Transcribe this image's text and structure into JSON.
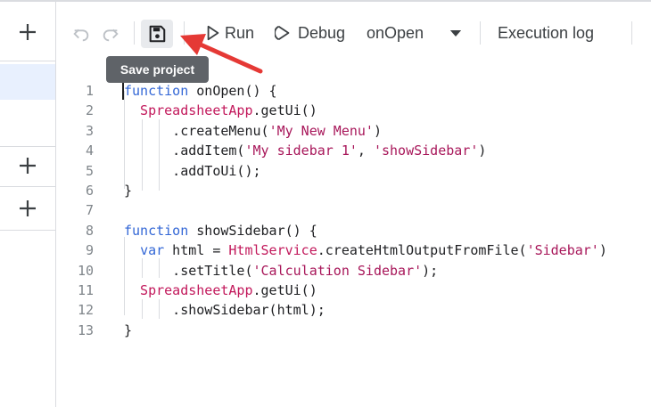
{
  "toolbar": {
    "run_label": "Run",
    "debug_label": "Debug",
    "function_select": "onOpen",
    "execution_log_label": "Execution log",
    "tooltip": "Save project"
  },
  "code_lines": [
    {
      "n": "1",
      "parts": [
        [
          "kw",
          "function"
        ],
        [
          "p",
          " onOpen() {"
        ]
      ]
    },
    {
      "n": "2",
      "parts": [
        [
          "cls",
          "  SpreadsheetApp"
        ],
        [
          "p",
          ".getUi()"
        ]
      ]
    },
    {
      "n": "3",
      "parts": [
        [
          "p",
          "      .createMenu("
        ],
        [
          "str",
          "'My New Menu'"
        ],
        [
          "p",
          ")"
        ]
      ]
    },
    {
      "n": "4",
      "parts": [
        [
          "p",
          "      .addItem("
        ],
        [
          "str",
          "'My sidebar 1'"
        ],
        [
          "p",
          ", "
        ],
        [
          "str",
          "'showSidebar'"
        ],
        [
          "p",
          ")"
        ]
      ]
    },
    {
      "n": "5",
      "parts": [
        [
          "p",
          "      .addToUi();"
        ]
      ]
    },
    {
      "n": "6",
      "parts": [
        [
          "p",
          "}"
        ]
      ]
    },
    {
      "n": "7",
      "parts": [
        [
          "p",
          ""
        ]
      ]
    },
    {
      "n": "8",
      "parts": [
        [
          "kw",
          "function"
        ],
        [
          "p",
          " showSidebar() {"
        ]
      ]
    },
    {
      "n": "9",
      "parts": [
        [
          "p",
          "  "
        ],
        [
          "kw",
          "var"
        ],
        [
          "p",
          " html = "
        ],
        [
          "cls",
          "HtmlService"
        ],
        [
          "p",
          ".createHtmlOutputFromFile("
        ],
        [
          "str",
          "'Sidebar'"
        ],
        [
          "p",
          ")"
        ]
      ]
    },
    {
      "n": "10",
      "parts": [
        [
          "p",
          "      .setTitle("
        ],
        [
          "str",
          "'Calculation Sidebar'"
        ],
        [
          "p",
          ");"
        ]
      ]
    },
    {
      "n": "11",
      "parts": [
        [
          "cls",
          "  SpreadsheetApp"
        ],
        [
          "p",
          ".getUi()"
        ]
      ]
    },
    {
      "n": "12",
      "parts": [
        [
          "p",
          "      .showSidebar(html);"
        ]
      ]
    },
    {
      "n": "13",
      "parts": [
        [
          "p",
          "}"
        ]
      ]
    }
  ],
  "colors": {
    "keyword": "#3367d6",
    "string": "#a8175a",
    "class": "#c2185b",
    "arrow": "#e53935"
  }
}
